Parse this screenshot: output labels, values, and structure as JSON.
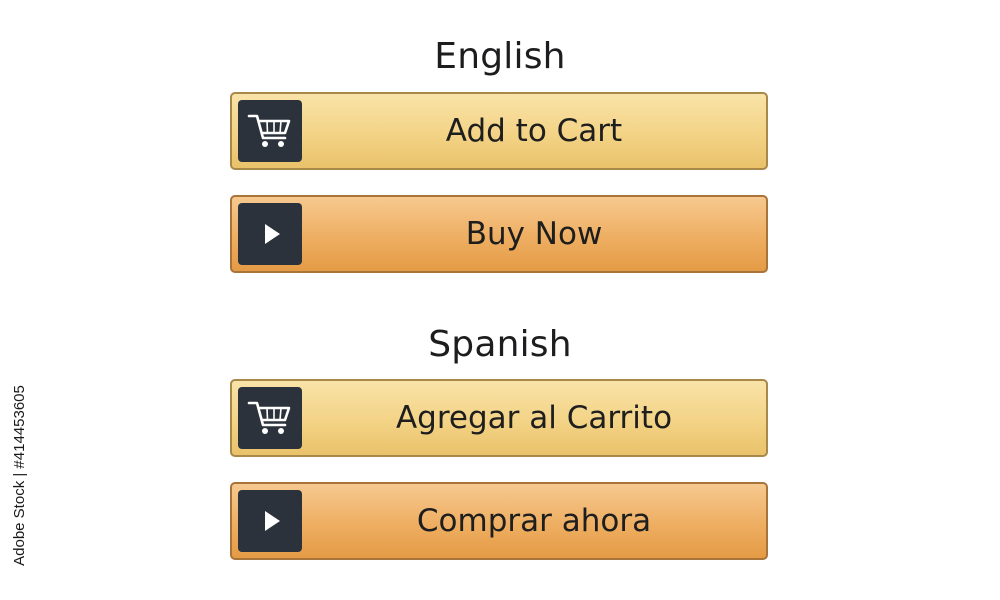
{
  "sections": [
    {
      "title": "English",
      "buttons": [
        {
          "label": "Add to Cart",
          "icon": "cart-icon"
        },
        {
          "label": "Buy Now",
          "icon": "play-icon"
        }
      ]
    },
    {
      "title": "Spanish",
      "buttons": [
        {
          "label": "Agregar al Carrito",
          "icon": "cart-icon"
        },
        {
          "label": "Comprar ahora",
          "icon": "play-icon"
        }
      ]
    }
  ],
  "watermark": "Adobe Stock | #414453605",
  "colors": {
    "cart_button": "#f3d386",
    "buy_button": "#eeae62",
    "icon_box": "#2c323b",
    "text": "#1e1e1e"
  }
}
